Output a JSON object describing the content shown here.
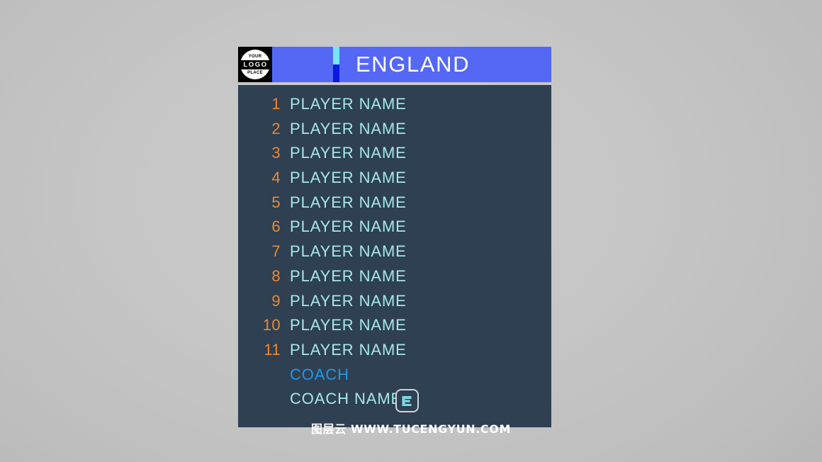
{
  "background": {
    "color": "#c6c6c6"
  },
  "graphic": {
    "logo": {
      "top_text": "YOUR",
      "mid_text": "LOGO",
      "bottom_text": "PLACE",
      "box_color": "#000000"
    },
    "header": {
      "team_name": "ENGLAND",
      "bar_color": "#5468f5",
      "title_color": "#ffffff",
      "accent_top_color": "#74e8f2",
      "accent_bottom_color": "#0a18e0"
    },
    "roster": {
      "panel_color": "#2e4052",
      "number_color": "#ef8730",
      "name_color": "#a6e8e8",
      "players": [
        {
          "number": "1",
          "name": "PLAYER NAME"
        },
        {
          "number": "2",
          "name": "PLAYER NAME"
        },
        {
          "number": "3",
          "name": "PLAYER NAME"
        },
        {
          "number": "4",
          "name": "PLAYER NAME"
        },
        {
          "number": "5",
          "name": "PLAYER NAME"
        },
        {
          "number": "6",
          "name": "PLAYER NAME"
        },
        {
          "number": "7",
          "name": "PLAYER NAME"
        },
        {
          "number": "8",
          "name": "PLAYER NAME"
        },
        {
          "number": "9",
          "name": "PLAYER NAME"
        },
        {
          "number": "10",
          "name": "PLAYER NAME"
        },
        {
          "number": "11",
          "name": "PLAYER NAME"
        }
      ],
      "coach_label": "COACH",
      "coach_label_color": "#2196e8",
      "coach_name": "COACH NAME"
    },
    "tool_badge": {
      "icon": "text-tool-icon",
      "icon_color": "#7fd8e0",
      "border_color": "#cfd4d8"
    }
  },
  "watermark": {
    "text": "图层云 WWW.TUCENGYUN.COM",
    "color": "#ffffff"
  }
}
